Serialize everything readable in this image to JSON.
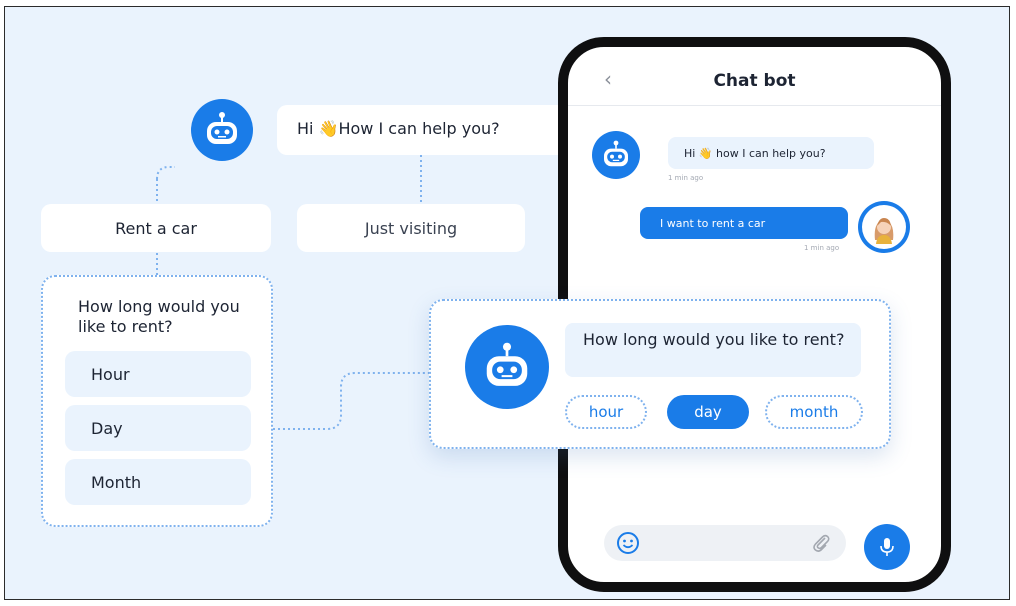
{
  "flow": {
    "greeting": "Hi 👋How I can help you?",
    "choices": [
      "Rent a car",
      "Just visiting"
    ],
    "panel": {
      "question": "How long would you like to rent?",
      "options": [
        "Hour",
        "Day",
        "Month"
      ]
    }
  },
  "phone": {
    "title": "Chat bot",
    "back_icon": "chevron-left-icon",
    "bot_message": "Hi 👋 how I can help you?",
    "bot_time": "1 min ago",
    "user_message": "I want to rent a car",
    "user_time": "1 min ago"
  },
  "overlay": {
    "question": "How long would you like to rent?",
    "options": [
      "hour",
      "day",
      "month"
    ],
    "selected": "day"
  },
  "icons": [
    "robot-icon",
    "user-avatar-icon",
    "smile-icon",
    "paperclip-icon",
    "microphone-icon"
  ],
  "colors": {
    "accent": "#1a7ce8",
    "background": "#eaf3fd",
    "card": "#ffffff"
  }
}
